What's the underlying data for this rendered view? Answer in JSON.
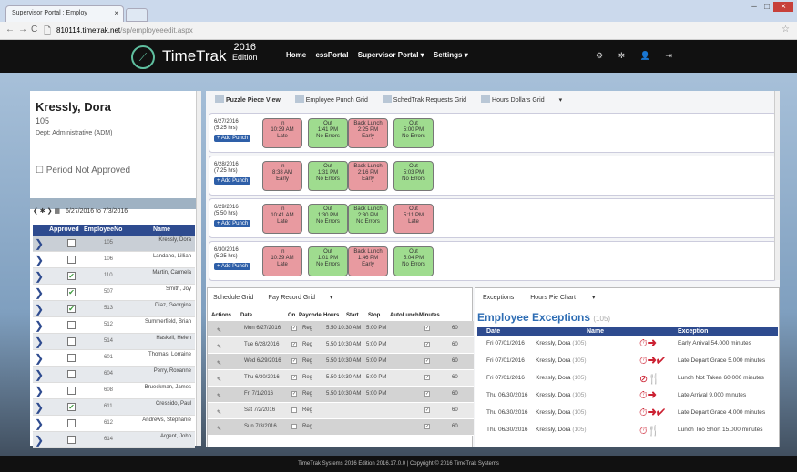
{
  "browser": {
    "tab_title": "Supervisor Portal : Employ",
    "tab_close": "×",
    "url_domain": "810114.timetrak.net",
    "url_path": "/sp/employeeedit.aspx",
    "win_min": "–",
    "win_max": "□",
    "win_close": "×",
    "back": "←",
    "forward": "→",
    "reload": "C",
    "page": "🗋",
    "star": "☆"
  },
  "header": {
    "logo_glyph": "⟋",
    "brand": "TimeTrak",
    "edition_year": "2016",
    "edition_word": "Edition",
    "nav": [
      "Home",
      "essPortal",
      "Supervisor Portal ▾",
      "Settings ▾"
    ],
    "icons": {
      "settings": "⚙",
      "gear": "✲",
      "user": "👤",
      "logout": "⇥"
    }
  },
  "employee": {
    "name": "Kressly, Dora",
    "id": "105",
    "dept": "Dept: Administrative (ADM)",
    "period_status": "☐ Period Not Approved"
  },
  "week": {
    "nav": "❮  ✱  ❯  ▦",
    "range": "6/27/2016 to 7/3/2016"
  },
  "emp_table": {
    "headers": [
      "Approved",
      "EmployeeNo",
      "Name"
    ],
    "rows": [
      {
        "no": "105",
        "name": "Kressly, Dora",
        "approved": false,
        "selected": true
      },
      {
        "no": "106",
        "name": "Landano, Lillian",
        "approved": false
      },
      {
        "no": "110",
        "name": "Martin, Carmela",
        "approved": true
      },
      {
        "no": "507",
        "name": "Smith, Joy",
        "approved": true
      },
      {
        "no": "513",
        "name": "Diaz, Georgina",
        "approved": true
      },
      {
        "no": "512",
        "name": "Summerfield, Brian",
        "approved": false
      },
      {
        "no": "514",
        "name": "Haskell, Helen",
        "approved": false
      },
      {
        "no": "601",
        "name": "Thomas, Lorraine",
        "approved": false
      },
      {
        "no": "604",
        "name": "Perry, Roxanne",
        "approved": false
      },
      {
        "no": "608",
        "name": "Brueckman, James",
        "approved": false
      },
      {
        "no": "611",
        "name": "Cressido, Paul",
        "approved": true
      },
      {
        "no": "612",
        "name": "Andrews, Stephanie",
        "approved": false
      },
      {
        "no": "614",
        "name": "Argent, John",
        "approved": false
      }
    ]
  },
  "grid_tabs": [
    "Puzzle Piece View",
    "Employee Punch Grid",
    "SchedTrak Requests Grid",
    "Hours Dollars Grid",
    "▾"
  ],
  "add_punch": "+ Add Punch",
  "days": [
    {
      "date": "6/27/2016",
      "hrs": "(5.25 hrs)",
      "punches": [
        {
          "t": "In",
          "time": "10:39 AM",
          "s": "Late",
          "c": "red"
        },
        {
          "t": "Out",
          "time": "1:41 PM",
          "s": "No Errors",
          "c": "green"
        },
        {
          "t": "Back Lunch",
          "time": "2:25 PM",
          "s": "Early",
          "c": "red"
        },
        {
          "t": "Out",
          "time": "5:00 PM",
          "s": "No Errors",
          "c": "green"
        }
      ]
    },
    {
      "date": "6/28/2016",
      "hrs": "(7.25 hrs)",
      "punches": [
        {
          "t": "In",
          "time": "8:38 AM",
          "s": "Early",
          "c": "red"
        },
        {
          "t": "Out",
          "time": "1:31 PM",
          "s": "No Errors",
          "c": "green"
        },
        {
          "t": "Back Lunch",
          "time": "2:16 PM",
          "s": "Early",
          "c": "red"
        },
        {
          "t": "Out",
          "time": "5:03 PM",
          "s": "No Errors",
          "c": "green"
        }
      ]
    },
    {
      "date": "6/29/2016",
      "hrs": "(5.50 hrs)",
      "punches": [
        {
          "t": "In",
          "time": "10:41 AM",
          "s": "Late",
          "c": "red"
        },
        {
          "t": "Out",
          "time": "1:30 PM",
          "s": "No Errors",
          "c": "green"
        },
        {
          "t": "Back Lunch",
          "time": "2:30 PM",
          "s": "No Errors",
          "c": "green"
        },
        {
          "t": "Out",
          "time": "5:11 PM",
          "s": "Late",
          "c": "red"
        }
      ]
    },
    {
      "date": "6/30/2016",
      "hrs": "(5.25 hrs)",
      "punches": [
        {
          "t": "In",
          "time": "10:39 AM",
          "s": "Late",
          "c": "red"
        },
        {
          "t": "Out",
          "time": "1:01 PM",
          "s": "No Errors",
          "c": "green"
        },
        {
          "t": "Back Lunch",
          "time": "1:46 PM",
          "s": "Early",
          "c": "red"
        },
        {
          "t": "Out",
          "time": "5:04 PM",
          "s": "No Errors",
          "c": "green"
        }
      ]
    }
  ],
  "sched_tabs": [
    "Schedule Grid",
    "Pay Record Grid",
    "▾"
  ],
  "sched_headers": [
    "Actions",
    "Date",
    "On",
    "Paycode",
    "Hours",
    "Start",
    "Stop",
    "AutoLunch",
    "Minutes"
  ],
  "sched_rows": [
    {
      "date": "Mon 6/27/2016",
      "on": true,
      "pay": "Reg",
      "hrs": "5.50",
      "start": "10:30 AM",
      "stop": "5:00 PM",
      "al": true,
      "min": "60"
    },
    {
      "date": "Tue 6/28/2016",
      "on": true,
      "pay": "Reg",
      "hrs": "5.50",
      "start": "10:30 AM",
      "stop": "5:00 PM",
      "al": true,
      "min": "60"
    },
    {
      "date": "Wed 6/29/2016",
      "on": true,
      "pay": "Reg",
      "hrs": "5.50",
      "start": "10:30 AM",
      "stop": "5:00 PM",
      "al": true,
      "min": "60"
    },
    {
      "date": "Thu 6/30/2016",
      "on": true,
      "pay": "Reg",
      "hrs": "5.50",
      "start": "10:30 AM",
      "stop": "5:00 PM",
      "al": true,
      "min": "60"
    },
    {
      "date": "Fri 7/1/2016",
      "on": true,
      "pay": "Reg",
      "hrs": "5.50",
      "start": "10:30 AM",
      "stop": "5:00 PM",
      "al": true,
      "min": "60"
    },
    {
      "date": "Sat 7/2/2016",
      "on": false,
      "pay": "Reg",
      "hrs": "",
      "start": "",
      "stop": "",
      "al": true,
      "min": "60"
    },
    {
      "date": "Sun 7/3/2016",
      "on": false,
      "pay": "Reg",
      "hrs": "",
      "start": "",
      "stop": "",
      "al": true,
      "min": "60"
    }
  ],
  "exc_tabs": [
    "Exceptions",
    "Hours Pie Chart",
    "▾"
  ],
  "exc_title": "Employee Exceptions",
  "exc_count": "(105)",
  "exc_headers": [
    "Date",
    "Name",
    "Exception"
  ],
  "exc_rows": [
    {
      "date": "Fri 07/01/2016",
      "name": "Kressly, Dora",
      "id": "(105)",
      "icon": "⏱➜",
      "exc": "Early Arrival 54.000 minutes"
    },
    {
      "date": "Fri 07/01/2016",
      "name": "Kressly, Dora",
      "id": "(105)",
      "icon": "⏱➜✔",
      "exc": "Late Depart Grace 5.000 minutes"
    },
    {
      "date": "Fri 07/01/2016",
      "name": "Kressly, Dora",
      "id": "(105)",
      "icon": "⊘🍴",
      "exc": "Lunch Not Taken 60.000 minutes"
    },
    {
      "date": "Thu 06/30/2016",
      "name": "Kressly, Dora",
      "id": "(105)",
      "icon": "⏱➜",
      "exc": "Late Arrival 9.000 minutes"
    },
    {
      "date": "Thu 06/30/2016",
      "name": "Kressly, Dora",
      "id": "(105)",
      "icon": "⏱➜✔",
      "exc": "Late Depart Grace 4.000 minutes"
    },
    {
      "date": "Thu 06/30/2016",
      "name": "Kressly, Dora",
      "id": "(105)",
      "icon": "⏱🍴",
      "exc": "Lunch Too Short 15.000 minutes"
    }
  ],
  "footer": "TimeTrak Systems 2016 Edition 2016.17.0.0  |  Copyright © 2016 TimeTrak Systems",
  "colors": {
    "accent": "#2e4b8f",
    "late": "#e89aa0",
    "ok": "#9fdc8f"
  }
}
